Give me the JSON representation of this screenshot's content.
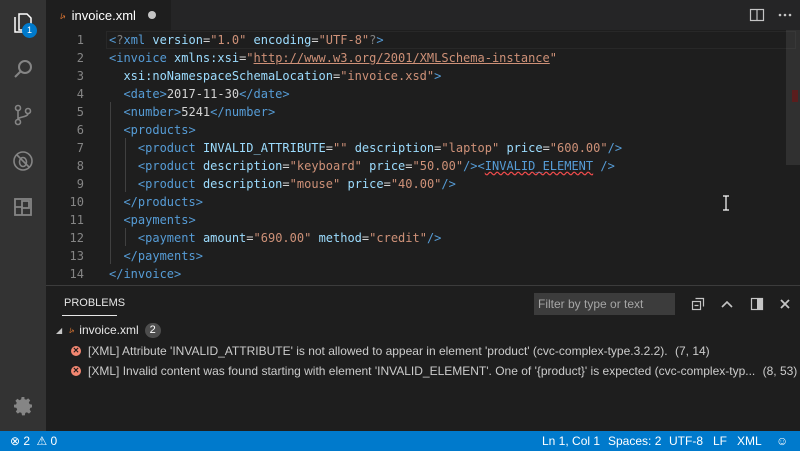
{
  "activity_bar": {
    "explorer_badge": "1",
    "icons": [
      "files-icon",
      "search-icon",
      "source-control-icon",
      "debug-icon",
      "extensions-icon",
      "gear-icon"
    ]
  },
  "tab": {
    "file_name": "invoice.xml",
    "modified": true
  },
  "editor": {
    "line_numbers": [
      "1",
      "2",
      "3",
      "4",
      "5",
      "6",
      "7",
      "8",
      "9",
      "10",
      "11",
      "12",
      "13",
      "14"
    ]
  },
  "panel": {
    "title": "PROBLEMS",
    "filter_placeholder": "Filter by type or text",
    "file": {
      "name": "invoice.xml",
      "count": "2"
    },
    "problems": [
      {
        "source": "[XML]",
        "message": "Attribute 'INVALID_ATTRIBUTE' is not allowed to appear in element 'product' (cvc-complex-type.3.2.2).",
        "location": "(7, 14)"
      },
      {
        "source": "[XML]",
        "message": "Invalid content was found starting with element 'INVALID_ELEMENT'. One of '{product}' is expected (cvc-complex-typ...",
        "location": "(8, 53)"
      }
    ]
  },
  "status_bar": {
    "errors": "2",
    "warnings": "0",
    "cursor": "Ln 1, Col 1",
    "spaces": "Spaces: 2",
    "encoding": "UTF-8",
    "eol": "LF",
    "language": "XML"
  },
  "colors": {
    "status_bar": "#007acc",
    "activity_bar": "#333333",
    "editor_bg": "#1e1e1e",
    "tag": "#569cd6",
    "attribute": "#9cdcfe",
    "string": "#ce9178",
    "error": "#f48771"
  }
}
